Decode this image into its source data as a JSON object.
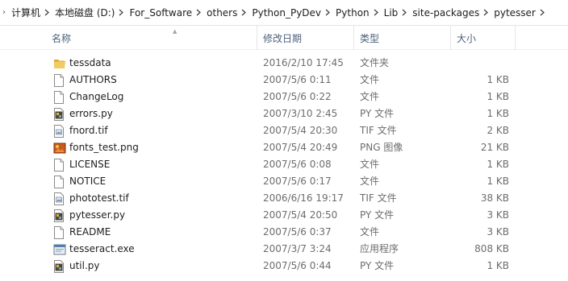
{
  "breadcrumb": [
    {
      "label": "计算机"
    },
    {
      "label": "本地磁盘 (D:)"
    },
    {
      "label": "For_Software"
    },
    {
      "label": "others"
    },
    {
      "label": "Python_PyDev"
    },
    {
      "label": "Python"
    },
    {
      "label": "Lib"
    },
    {
      "label": "site-packages"
    },
    {
      "label": "pytesser"
    }
  ],
  "columns": {
    "name": "名称",
    "date": "修改日期",
    "type": "类型",
    "size": "大小"
  },
  "files": [
    {
      "icon": "folder-icon",
      "name": "tessdata",
      "date": "2016/2/10 17:45",
      "type": "文件夹",
      "size": ""
    },
    {
      "icon": "blank-file-icon",
      "name": "AUTHORS",
      "date": "2007/5/6 0:11",
      "type": "文件",
      "size": "1 KB"
    },
    {
      "icon": "blank-file-icon",
      "name": "ChangeLog",
      "date": "2007/5/6 0:22",
      "type": "文件",
      "size": "1 KB"
    },
    {
      "icon": "python-file-icon",
      "name": "errors.py",
      "date": "2007/3/10 2:45",
      "type": "PY 文件",
      "size": "1 KB"
    },
    {
      "icon": "tif-file-icon",
      "name": "fnord.tif",
      "date": "2007/5/4 20:30",
      "type": "TIF 文件",
      "size": "2 KB"
    },
    {
      "icon": "png-file-icon",
      "name": "fonts_test.png",
      "date": "2007/5/4 20:49",
      "type": "PNG 图像",
      "size": "21 KB"
    },
    {
      "icon": "blank-file-icon",
      "name": "LICENSE",
      "date": "2007/5/6 0:08",
      "type": "文件",
      "size": "1 KB"
    },
    {
      "icon": "blank-file-icon",
      "name": "NOTICE",
      "date": "2007/5/6 0:17",
      "type": "文件",
      "size": "1 KB"
    },
    {
      "icon": "tif-file-icon",
      "name": "phototest.tif",
      "date": "2006/6/16 19:17",
      "type": "TIF 文件",
      "size": "38 KB"
    },
    {
      "icon": "python-file-icon",
      "name": "pytesser.py",
      "date": "2007/5/4 20:50",
      "type": "PY 文件",
      "size": "3 KB"
    },
    {
      "icon": "blank-file-icon",
      "name": "README",
      "date": "2007/5/6 0:37",
      "type": "文件",
      "size": "3 KB"
    },
    {
      "icon": "exe-file-icon",
      "name": "tesseract.exe",
      "date": "2007/3/7 3:24",
      "type": "应用程序",
      "size": "808 KB"
    },
    {
      "icon": "python-file-icon",
      "name": "util.py",
      "date": "2007/5/6 0:44",
      "type": "PY 文件",
      "size": "1 KB"
    }
  ]
}
